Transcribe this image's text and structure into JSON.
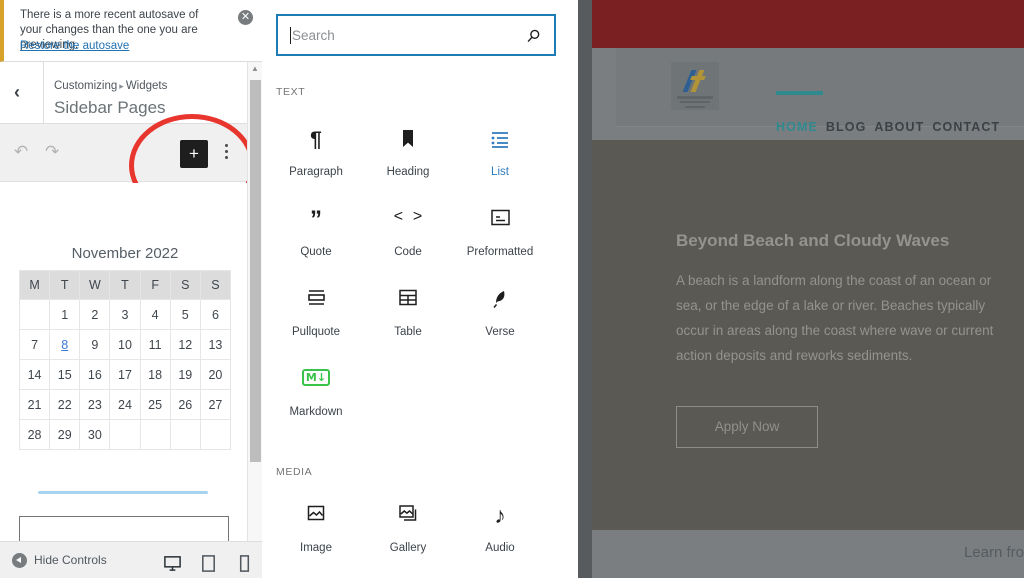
{
  "notice": {
    "text": "There is a more recent autosave of your changes than the one you are previewing.",
    "link": "Restore the autosave",
    "close_icon": "close-icon",
    "accent": "#d7a22a"
  },
  "panel": {
    "back_icon": "chevron-left-icon",
    "breadcrumb_root": "Customizing",
    "breadcrumb_sep": "▸",
    "breadcrumb_current": "Widgets",
    "title": "Sidebar Pages"
  },
  "toolbar": {
    "undo_icon": "undo-icon",
    "redo_icon": "redo-icon",
    "add_label": "+",
    "options_icon": "kebab-menu-icon",
    "highlight_color": "#e8352e"
  },
  "calendar": {
    "title": "November 2022",
    "weekdays": [
      "M",
      "T",
      "W",
      "T",
      "F",
      "S",
      "S"
    ],
    "weeks": [
      [
        "",
        "1",
        "2",
        "3",
        "4",
        "5",
        "6"
      ],
      [
        "7",
        "8",
        "9",
        "10",
        "11",
        "12",
        "13"
      ],
      [
        "14",
        "15",
        "16",
        "17",
        "18",
        "19",
        "20"
      ],
      [
        "21",
        "22",
        "23",
        "24",
        "25",
        "26",
        "27"
      ],
      [
        "28",
        "29",
        "30",
        "",
        "",
        "",
        ""
      ]
    ],
    "today": "8",
    "today_color": "#3a7bd5"
  },
  "footer": {
    "hide_controls_label": "Hide Controls",
    "hide_icon": "collapse-arrow-icon",
    "devices": [
      {
        "name": "desktop-preview-button",
        "icon": "desktop-icon",
        "active": true
      },
      {
        "name": "tablet-preview-button",
        "icon": "tablet-icon",
        "active": false
      },
      {
        "name": "mobile-preview-button",
        "icon": "mobile-icon",
        "active": false
      }
    ]
  },
  "inserter": {
    "search": {
      "value": "",
      "placeholder": "Search",
      "icon": "search-icon",
      "focus_color": "#1c7cb5"
    },
    "sections": [
      {
        "label": "TEXT",
        "blocks": [
          {
            "label": "Paragraph",
            "icon": "pilcrow-icon",
            "highlighted": false
          },
          {
            "label": "Heading",
            "icon": "bookmark-icon",
            "highlighted": false
          },
          {
            "label": "List",
            "icon": "list-icon",
            "highlighted": true
          },
          {
            "label": "Quote",
            "icon": "quote-icon",
            "highlighted": false
          },
          {
            "label": "Code",
            "icon": "angle-brackets-icon",
            "highlighted": false
          },
          {
            "label": "Preformatted",
            "icon": "preformatted-icon",
            "highlighted": false
          },
          {
            "label": "Pullquote",
            "icon": "pullquote-icon",
            "highlighted": false
          },
          {
            "label": "Table",
            "icon": "table-icon",
            "highlighted": false
          },
          {
            "label": "Verse",
            "icon": "feather-icon",
            "highlighted": false
          },
          {
            "label": "Markdown",
            "icon": "markdown-icon",
            "highlighted": false
          }
        ]
      },
      {
        "label": "MEDIA",
        "blocks": [
          {
            "label": "Image",
            "icon": "image-icon",
            "highlighted": false
          },
          {
            "label": "Gallery",
            "icon": "gallery-icon",
            "highlighted": false
          },
          {
            "label": "Audio",
            "icon": "audio-note-icon",
            "highlighted": false
          }
        ]
      }
    ]
  },
  "preview": {
    "topbar_color": "#7a1f22",
    "logo_alt": "site-logo",
    "nav": [
      "HOME",
      "BLOG",
      "ABOUT",
      "CONTACT"
    ],
    "nav_active": "HOME",
    "nav_active_color": "#2f8a8f",
    "hero": {
      "title": "Beyond Beach and Cloudy Waves",
      "body": "A beach is a landform along the coast of an ocean or sea, or the edge of a lake or river. Beaches typically occur in areas along the coast where wave or current action deposits and reworks sediments.",
      "button": "Apply Now"
    },
    "next_section_text": "Learn fro"
  }
}
